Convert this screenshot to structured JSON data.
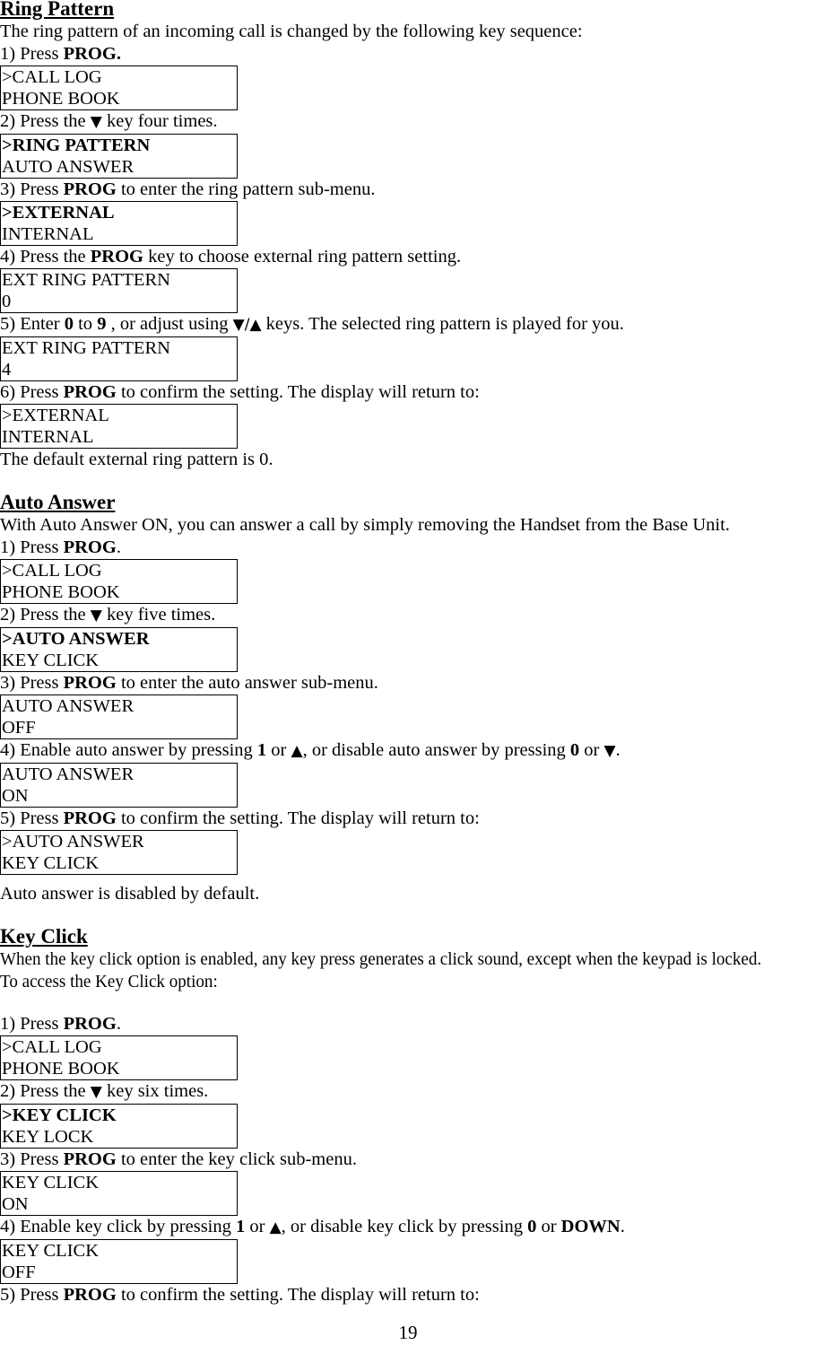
{
  "document": {
    "page_number": "19"
  },
  "sections": [
    {
      "id": "ring-pattern",
      "heading": "Ring Pattern",
      "intro": "The ring pattern of an incoming call is changed by the following key sequence:",
      "steps": [
        {
          "n": "1)",
          "text_parts": [
            "1) Press ",
            "PROG."
          ],
          "full": "1) Press PROG.",
          "screen": {
            "line1": ">CALL LOG",
            "line2": " PHONE BOOK",
            "line1_bold": false
          }
        },
        {
          "n": "2)",
          "full": "2) Press the ▼ key four times.",
          "screen": {
            "line1": ">RING PATTERN",
            "line2": " AUTO ANSWER",
            "line1_bold": true
          }
        },
        {
          "n": "3)",
          "full": "3) Press PROG to enter the ring pattern sub-menu.",
          "screen": {
            "line1": ">EXTERNAL",
            "line2": " INTERNAL",
            "line1_bold": true
          }
        },
        {
          "n": "4)",
          "full": "4) Press the PROG key to choose external ring pattern setting.",
          "screen": {
            "line1": "EXT RING PATTERN",
            "line2": "0",
            "line1_bold": false
          }
        },
        {
          "n": "5)",
          "full": "5) Enter  0 to 9 , or adjust using ▼/▲ keys. The selected ring pattern is played for you.",
          "screen": {
            "line1": "EXT RING PATTERN",
            "line2": "4",
            "line1_bold": false
          }
        },
        {
          "n": "6)",
          "full": "6) Press PROG to confirm the setting.  The display will return to:",
          "screen": {
            "line1": ">EXTERNAL",
            "line2": " INTERNAL",
            "line1_bold": false
          }
        }
      ],
      "footer": "The default external ring pattern is 0."
    },
    {
      "id": "auto-answer",
      "heading": "Auto Answer",
      "intro": "With Auto Answer ON, you can answer a call by simply removing the Handset from the Base Unit.",
      "steps": [
        {
          "n": "1)",
          "full": "1) Press PROG.",
          "screen": {
            "line1": ">CALL LOG",
            "line2": " PHONE BOOK",
            "line1_bold": false
          }
        },
        {
          "n": "2)",
          "full": "2) Press the ▼ key five times.",
          "screen": {
            "line1": ">AUTO ANSWER",
            "line2": " KEY CLICK",
            "line1_bold": true
          }
        },
        {
          "n": "3)",
          "full": "3) Press PROG to enter the auto answer sub-menu.",
          "screen": {
            "line1": "AUTO ANSWER",
            "line2": "OFF",
            "line1_bold": false
          }
        },
        {
          "n": "4)",
          "full": "4) Enable auto answer by pressing 1 or ▲, or disable auto answer by pressing  0 or ▼.",
          "screen": {
            "line1": "AUTO ANSWER",
            "line2": "ON",
            "line1_bold": false
          }
        },
        {
          "n": "5)",
          "full": "5) Press PROG to confirm the setting.  The display will return to:",
          "screen": {
            "line1": ">AUTO ANSWER",
            "line2": " KEY CLICK",
            "line1_bold": false
          }
        }
      ],
      "footer": "Auto answer is disabled by default."
    },
    {
      "id": "key-click",
      "heading": "Key Click",
      "intro": "When the key click option is enabled, any key press generates a click sound, except when the keypad is locked.",
      "intro2": "To access the Key Click option:",
      "steps": [
        {
          "n": "1)",
          "full": "1) Press PROG.",
          "screen": {
            "line1": ">CALL LOG",
            "line2": " PHONE BOOK",
            "line1_bold": false
          }
        },
        {
          "n": "2)",
          "full": "2) Press the ▼ key six times.",
          "screen": {
            "line1": ">KEY CLICK",
            "line2": " KEY LOCK",
            "line1_bold": true
          }
        },
        {
          "n": "3)",
          "full": "3) Press PROG to enter the key click sub-menu.",
          "screen": {
            "line1": "KEY CLICK",
            "line2": "ON",
            "line1_bold": false
          }
        },
        {
          "n": "4)",
          "full": "4) Enable key click by pressing 1 or ▲, or disable key click by pressing  0 or DOWN.",
          "screen": {
            "line1": "KEY CLICK",
            "line2": "OFF",
            "line1_bold": false
          }
        },
        {
          "n": "5)",
          "full": "5) Press PROG to confirm the setting.  The display will return to:",
          "screen": null
        }
      ],
      "footer": ""
    }
  ],
  "inline": {
    "prog": "PROG",
    "prog_period": "PROG.",
    "down_word": "DOWN",
    "digit_0": "0",
    "digit_1": "1",
    "digit_9": "9",
    "arrow_down": "▼",
    "arrow_up": "▲"
  },
  "text_fragments": {
    "rp_step1_a": "1) Press ",
    "rp_step1_b": "PROG.",
    "rp_step2_a": "2) Press the ",
    "rp_step2_arrow": "▼",
    "rp_step2_b": " key four times.",
    "rp_step3_a": "3) Press ",
    "rp_step3_b": "PROG",
    "rp_step3_c": " to enter the ring pattern sub-menu.",
    "rp_step4_a": "4) Press the ",
    "rp_step4_b": "PROG",
    "rp_step4_c": " key to choose external ring pattern setting.",
    "rp_step5_a": "5) Enter  ",
    "rp_step5_b": "0",
    "rp_step5_c": " to ",
    "rp_step5_d": "9",
    "rp_step5_e": " , or adjust using ",
    "rp_step5_arrows": "▼/▲",
    "rp_step5_f": " keys. The selected ring pattern is played for you.",
    "rp_step6_a": "6) Press ",
    "rp_step6_b": "PROG",
    "rp_step6_c": " to confirm the setting.  The display will return to:",
    "rp_footer": "The default external ring pattern is 0.",
    "aa_step1_a": "1) Press ",
    "aa_step1_b": "PROG",
    "aa_step1_c": ".",
    "aa_step2_a": "2) Press the ",
    "aa_step2_arrow": "▼",
    "aa_step2_b": " key five times.",
    "aa_step3_a": "3) Press ",
    "aa_step3_b": "PROG",
    "aa_step3_c": " to enter the auto answer sub-menu.",
    "aa_step4_a": "4) Enable auto answer by pressing ",
    "aa_step4_b": "1",
    "aa_step4_c": " or ",
    "aa_step4_up": "▲",
    "aa_step4_d": ", or disable auto answer by pressing  ",
    "aa_step4_e": "0",
    "aa_step4_f": " or ",
    "aa_step4_down": "▼",
    "aa_step4_g": ".",
    "aa_step5_a": "5) Press ",
    "aa_step5_b": "PROG",
    "aa_step5_c": " to confirm the setting.  The display will return to:",
    "aa_footer": "Auto answer is disabled by default.",
    "kc_intro": "When the key click option is enabled, any key press generates a click sound, except when the keypad is locked.",
    "kc_intro2": "To access the Key Click option:",
    "kc_step1_a": "1) Press ",
    "kc_step1_b": "PROG",
    "kc_step1_c": ".",
    "kc_step2_a": "2) Press the ",
    "kc_step2_arrow": "▼",
    "kc_step2_b": " key six times.",
    "kc_step3_a": "3) Press ",
    "kc_step3_b": "PROG",
    "kc_step3_c": " to enter the key click sub-menu.",
    "kc_step4_a": "4) Enable key click by pressing ",
    "kc_step4_b": "1",
    "kc_step4_c": " or ",
    "kc_step4_up": "▲",
    "kc_step4_d": ", or disable key click by pressing  ",
    "kc_step4_e": "0",
    "kc_step4_f": " or ",
    "kc_step4_g": "DOWN",
    "kc_step4_h": "."
  }
}
